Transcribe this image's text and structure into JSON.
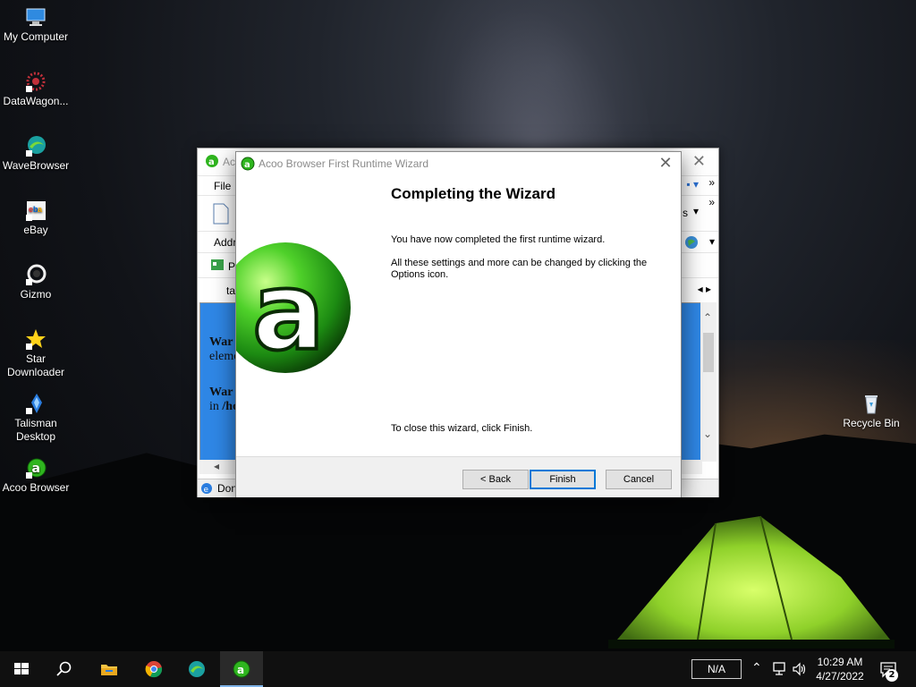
{
  "desktop": {
    "icons": [
      {
        "label": "My Computer",
        "icon": "computer-icon"
      },
      {
        "label": "DataWagon...",
        "icon": "datawagon-icon"
      },
      {
        "label": "WaveBrowser",
        "icon": "wavebrowser-icon"
      },
      {
        "label": "eBay",
        "icon": "ebay-icon"
      },
      {
        "label": "Gizmo",
        "icon": "gizmo-icon"
      },
      {
        "label": "Star Downloader",
        "icon": "star-icon"
      },
      {
        "label": "Talisman Desktop",
        "icon": "talisman-icon"
      },
      {
        "label": "Acoo Browser",
        "icon": "acoo-icon"
      },
      {
        "label": "Recycle Bin",
        "icon": "recycle-bin-icon"
      }
    ]
  },
  "background_window": {
    "title": "Ac",
    "menu_file": "File",
    "address_label": "Addr",
    "links_label": "Pl",
    "tab_label": "ta",
    "content_line1_bold": "War",
    "content_line1_rest": "eleme",
    "content_line2_bold": "War",
    "content_line2_prefix": "in",
    "content_line2_rest": "/ho",
    "toolbar_s": "s",
    "status_text": "Don"
  },
  "wizard": {
    "title": "Acoo Browser First Runtime Wizard",
    "heading": "Completing the Wizard",
    "para1": "You have now completed the first runtime wizard.",
    "para2": "All these settings and more can be changed by clicking the Options icon.",
    "para3": "To close this wizard, click Finish.",
    "back_label": "< Back",
    "finish_label": "Finish",
    "cancel_label": "Cancel",
    "logo_letter": "a"
  },
  "taskbar": {
    "na_label": "N/A",
    "time": "10:29 AM",
    "date": "4/27/2022",
    "notification_count": "2"
  },
  "colors": {
    "accent": "#0078d7",
    "acoo_green": "#2fb51f",
    "taskbar_bg": "#101010"
  }
}
